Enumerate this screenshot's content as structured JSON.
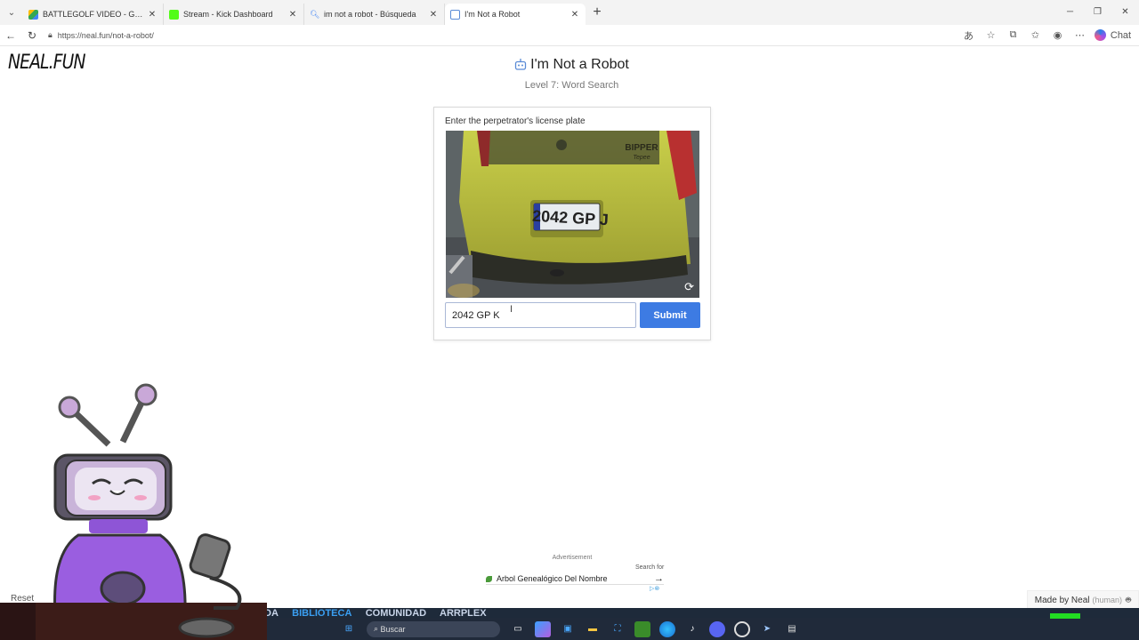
{
  "browser": {
    "tabs": [
      {
        "title": "BATTLEGOLF VIDEO - Google Drive",
        "favicon": "google-drive-icon",
        "color": "#34a853"
      },
      {
        "title": "Stream - Kick Dashboard",
        "favicon": "kick-icon",
        "color": "#53fc18"
      },
      {
        "title": "im not a robot - Búsqueda",
        "favicon": "search-icon",
        "color": "#4285f4"
      },
      {
        "title": "I'm Not a Robot",
        "favicon": "robot-icon",
        "color": "#5a8bd6"
      }
    ],
    "url": "https://neal.fun/not-a-robot/",
    "chat_label": "Chat"
  },
  "site": {
    "logo": "NEAL.FUN"
  },
  "page": {
    "title": "I'm Not a Robot",
    "subtitle": "Level 7: Word Search"
  },
  "captcha": {
    "instruction": "Enter the perpetrator's license plate",
    "plate_text": "2042 GP J",
    "van_brand": "BIPPER",
    "van_model": "Tepee",
    "input_value": "2042 GP K",
    "submit_label": "Submit"
  },
  "ad": {
    "label": "Advertisement",
    "search_for": "Search for",
    "link_text": "Arbol Genealógico Del Nombre"
  },
  "footer": {
    "made_by": "Made by Neal",
    "human": "(human)",
    "reset": "Reset"
  },
  "overlay": {
    "game_nav": [
      "DA",
      "BIBLIOTECA",
      "COMUNIDAD",
      "ARRPLEX"
    ],
    "taskbar_search": "Buscar"
  },
  "colors": {
    "accent": "#3d7be3",
    "van": "#b6bd3a"
  }
}
